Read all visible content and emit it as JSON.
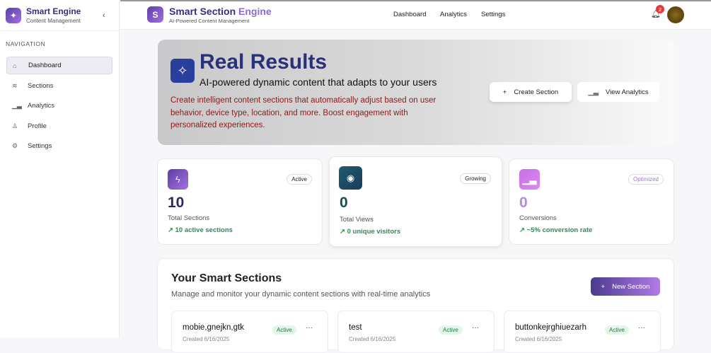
{
  "sidebar": {
    "brand_title": "Smart Engine",
    "brand_subtitle": "Content Management",
    "nav_label": "NAVIGATION",
    "items": [
      {
        "label": "Dashboard",
        "icon": "home-icon"
      },
      {
        "label": "Sections",
        "icon": "layers-icon"
      },
      {
        "label": "Analytics",
        "icon": "bar-chart-icon"
      },
      {
        "label": "Profile",
        "icon": "user-icon"
      },
      {
        "label": "Settings",
        "icon": "gear-icon"
      }
    ]
  },
  "header": {
    "logo_letter": "S",
    "title_a": "Smart Section",
    "title_b": " Engine",
    "subtitle": "AI-Powered Content Management",
    "nav": [
      "Dashboard",
      "Analytics",
      "Settings"
    ],
    "notifications": "2"
  },
  "hero": {
    "title": "Real Results",
    "subtitle": "AI-powered dynamic content that adapts to your users",
    "description": "Create intelligent content sections that automatically adjust based on user behavior, device type, location, and more. Boost engagement with personalized experiences.",
    "create_label": "Create Section",
    "analytics_label": "View Analytics"
  },
  "stats": [
    {
      "value": "10",
      "label": "Total Sections",
      "badge": "Active",
      "trend": "10 active sections",
      "color": "#2d2a5e"
    },
    {
      "value": "0",
      "label": "Total Views",
      "badge": "Growing",
      "trend": "0 unique visitors",
      "color": "#1b4b52"
    },
    {
      "value": "0",
      "label": "Conversions",
      "badge": "Optimized",
      "trend": "~5% conversion rate",
      "color": "#b28be0"
    }
  ],
  "sections": {
    "title": "Your Smart Sections",
    "subtitle": "Manage and monitor your dynamic content sections with real-time analytics",
    "new_label": "New Section",
    "cards": [
      {
        "name": "mobie,gnejkn,gtk",
        "status": "Active",
        "created": "Created 6/16/2025"
      },
      {
        "name": "test",
        "status": "Active",
        "created": "Created 6/16/2025"
      },
      {
        "name": "buttonkejrghiuezarh",
        "status": "Active",
        "created": "Created 6/16/2025"
      }
    ]
  }
}
